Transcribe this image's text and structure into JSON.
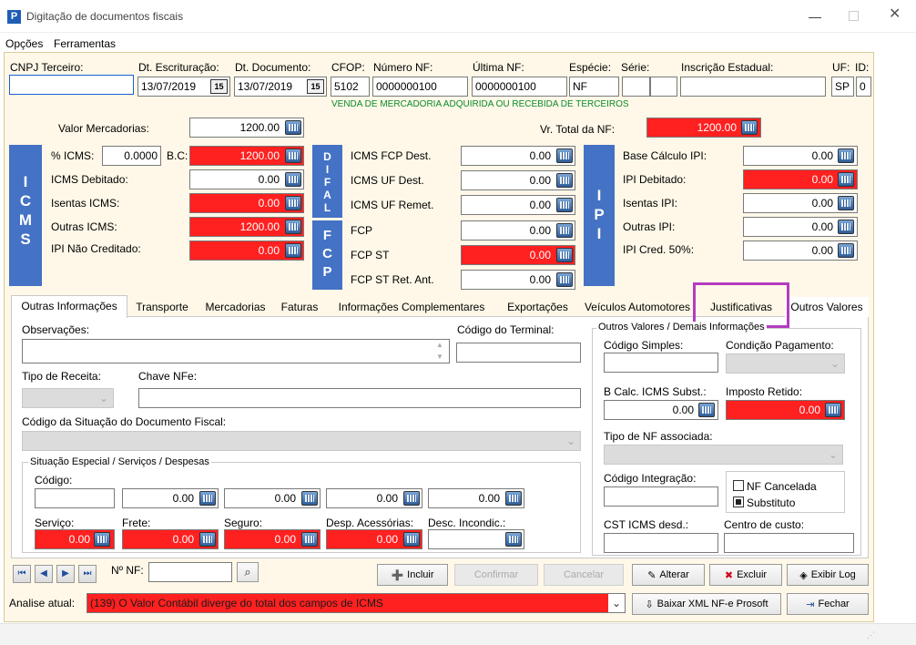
{
  "window": {
    "title": "Digitação de documentos fiscais",
    "app_icon": "P"
  },
  "menu": {
    "items": [
      "Opções",
      "Ferramentas"
    ]
  },
  "header": {
    "cnpj_label": "CNPJ Terceiro:",
    "cnpj_value": "",
    "dt_escrit_label": "Dt. Escrituração:",
    "dt_escrit_value": "13/07/2019",
    "dt_doc_label": "Dt. Documento:",
    "dt_doc_value": "13/07/2019",
    "cfop_label": "CFOP:",
    "cfop_value": "5102",
    "numero_label": "Número NF:",
    "numero_value": "0000000100",
    "ultima_label": "Última NF:",
    "ultima_value": "0000000100",
    "especie_label": "Espécie:",
    "especie_value": "NF",
    "serie_label": "Série:",
    "serie_value": "",
    "ie_label": "Inscrição Estadual:",
    "ie_value": "",
    "uf_label": "UF:",
    "uf_value": "SP",
    "id_label": "ID:",
    "id_value": "0",
    "cfop_desc": "VENDA DE MERCADORIA ADQUIRIDA OU RECEBIDA DE TERCEIROS",
    "calendar_badge": "15"
  },
  "values": {
    "valor_merc_label": "Valor Mercadorias:",
    "valor_merc": "1200.00",
    "vr_total_label": "Vr. Total da NF:",
    "vr_total": "1200.00"
  },
  "icms": {
    "band": "ICMS",
    "pct_label": "% ICMS:",
    "pct": "0.0000",
    "bc_label": "B.C:",
    "bc": "1200.00",
    "debitado_label": "ICMS Debitado:",
    "debitado": "0.00",
    "isentas_label": "Isentas ICMS:",
    "isentas": "0.00",
    "outras_label": "Outras ICMS:",
    "outras": "1200.00",
    "ipi_nc_label": "IPI Não Creditado:",
    "ipi_nc": "0.00"
  },
  "difal": {
    "band": "DIFAL",
    "band2": "FCP",
    "fcp_dest_label": "ICMS FCP Dest.",
    "fcp_dest": "0.00",
    "uf_dest_label": "ICMS UF Dest.",
    "uf_dest": "0.00",
    "uf_remet_label": "ICMS UF Remet.",
    "uf_remet": "0.00",
    "fcp_label": "FCP",
    "fcp": "0.00",
    "fcp_st_label": "FCP ST",
    "fcp_st": "0.00",
    "fcp_st_ret_label": "FCP ST Ret. Ant.",
    "fcp_st_ret": "0.00"
  },
  "ipi": {
    "band": "IPI",
    "base_label": "Base Cálculo IPI:",
    "base": "0.00",
    "debitado_label": "IPI Debitado:",
    "debitado": "0.00",
    "isentas_label": "Isentas IPI:",
    "isentas": "0.00",
    "outras_label": "Outras IPI:",
    "outras": "0.00",
    "cred_label": "IPI Cred. 50%:",
    "cred": "0.00"
  },
  "tabs": [
    "Outras Informações",
    "Transporte",
    "Mercadorias",
    "Faturas",
    "Informações Complementares",
    "Exportações",
    "Veículos Automotores",
    "Justificativas",
    "Outros Valores"
  ],
  "outras": {
    "obs_label": "Observações:",
    "obs": "",
    "terminal_label": "Código do Terminal:",
    "terminal": "",
    "tipo_receita_label": "Tipo de Receita:",
    "chave_label": "Chave NFe:",
    "chave": "",
    "situacao_label": "Código da Situação do Documento Fiscal:",
    "especial_title": "Situação Especial / Serviços / Despesas",
    "codigo_label": "Código:",
    "codigo": "",
    "field1": "0.00",
    "field2": "0.00",
    "field3": "0.00",
    "field4": "0.00",
    "servico_label": "Serviço:",
    "servico": "0.00",
    "frete_label": "Frete:",
    "frete": "0.00",
    "seguro_label": "Seguro:",
    "seguro": "0.00",
    "desp_label": "Desp. Acessórias:",
    "desp": "0.00",
    "desc_label": "Desc. Incondic.:",
    "desc": ""
  },
  "outros_valores": {
    "title": "Outros Valores / Demais Informações",
    "cod_simples_label": "Código Simples:",
    "cod_simples": "",
    "cond_pag_label": "Condição Pagamento:",
    "bcalc_label": "B Calc. ICMS Subst.:",
    "bcalc": "0.00",
    "imposto_label": "Imposto Retido:",
    "imposto": "0.00",
    "tipo_nf_label": "Tipo de NF associada:",
    "cod_integ_label": "Código Integração:",
    "cod_integ": "",
    "nf_cancelada_label": "NF Cancelada",
    "substituto_label": "Substituto",
    "cst_label": "CST ICMS desd.:",
    "cst": "",
    "centro_label": "Centro de custo:",
    "centro": ""
  },
  "footer": {
    "nf_label": "Nº NF:",
    "nf_value": "",
    "incluir": "Incluir",
    "confirmar": "Confirmar",
    "cancelar": "Cancelar",
    "alterar": "Alterar",
    "excluir": "Excluir",
    "exibir_log": "Exibir Log",
    "analise_label": "Analise atual:",
    "analise_value": "(139) O Valor Contábil diverge do total dos campos de ICMS",
    "baixar": "Baixar XML NF-e Prosoft",
    "fechar": "Fechar"
  },
  "colors": {
    "accent": "#4472c4",
    "error": "#ff2020",
    "highlight": "#b43cc0",
    "panel": "#fff8e8"
  }
}
